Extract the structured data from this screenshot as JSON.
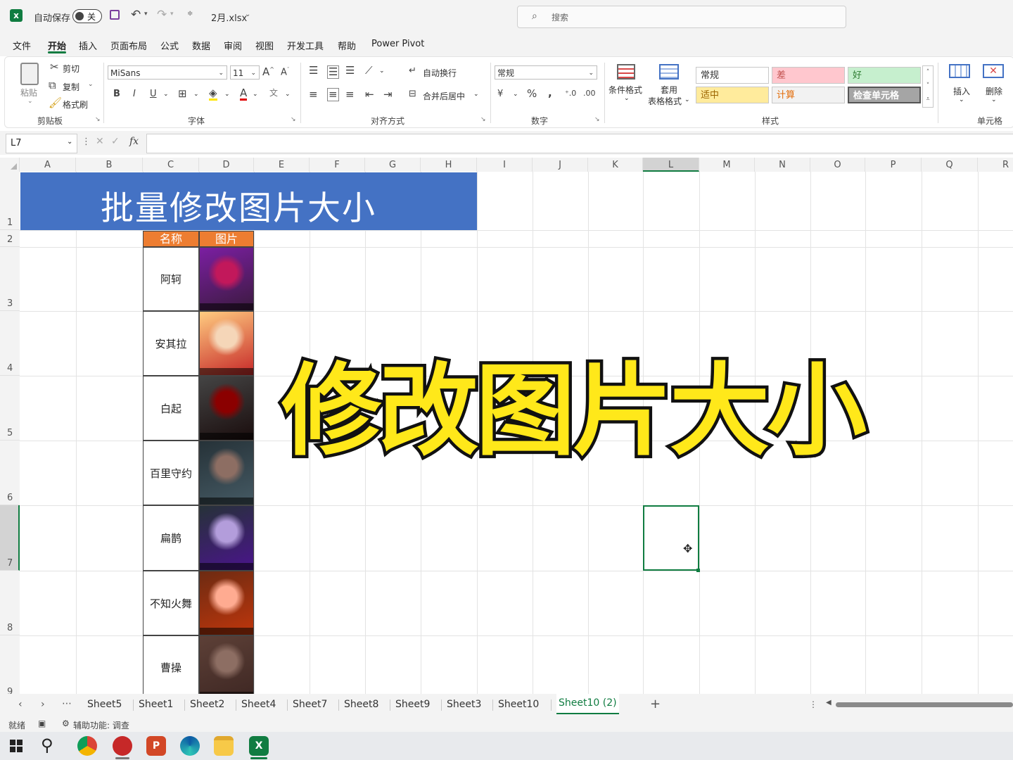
{
  "titlebar": {
    "autosave_label": "自动保存",
    "autosave_state": "关",
    "filename": "2月.xlsx",
    "search_placeholder": "搜索"
  },
  "menu": {
    "tabs": [
      "文件",
      "开始",
      "插入",
      "页面布局",
      "公式",
      "数据",
      "审阅",
      "视图",
      "开发工具",
      "帮助",
      "Power Pivot"
    ],
    "active": "开始"
  },
  "ribbon": {
    "clipboard": {
      "paste": "粘贴",
      "cut": "剪切",
      "copy": "复制",
      "format_painter": "格式刷",
      "label": "剪贴板"
    },
    "font": {
      "family": "MiSans",
      "size": "11",
      "label": "字体"
    },
    "alignment": {
      "wrap": "自动换行",
      "merge": "合并后居中",
      "label": "对齐方式"
    },
    "number": {
      "format": "常规",
      "label": "数字"
    },
    "styles": {
      "conditional": "条件格式",
      "table_format_1": "套用",
      "table_format_2": "表格格式",
      "label": "样式",
      "cells": [
        {
          "text": "常规",
          "bg": "#ffffff",
          "fg": "#333333"
        },
        {
          "text": "差",
          "bg": "#ffc7ce",
          "fg": "#c0504d"
        },
        {
          "text": "好",
          "bg": "#c6efce",
          "fg": "#2e7d32"
        },
        {
          "text": "适中",
          "bg": "#ffeb9c",
          "fg": "#9c6500"
        },
        {
          "text": "计算",
          "bg": "#f2f2f2",
          "fg": "#e36c09"
        },
        {
          "text": "检查单元格",
          "bg": "#a5a5a5",
          "fg": "#ffffff"
        }
      ]
    },
    "cells": {
      "insert": "插入",
      "delete": "删除",
      "label": "单元格"
    }
  },
  "formula": {
    "name_box": "L7",
    "fx": "fx",
    "value": ""
  },
  "grid": {
    "columns": [
      "A",
      "B",
      "C",
      "D",
      "E",
      "F",
      "G",
      "H",
      "I",
      "J",
      "K",
      "L",
      "M",
      "N",
      "O",
      "P",
      "Q",
      "R"
    ],
    "rows": [
      "1",
      "2",
      "3",
      "4",
      "5",
      "6",
      "7",
      "8",
      "9"
    ],
    "banner_title": "批量修改图片大小",
    "header_name": "名称",
    "header_pic": "图片",
    "names": [
      "阿轲",
      "安其拉",
      "白起",
      "百里守约",
      "扁鹊",
      "不知火舞",
      "曹操"
    ],
    "selected_cell": "L7",
    "overlay_caption": "修改图片大小"
  },
  "sheets": {
    "tabs": [
      "Sheet5",
      "Sheet1",
      "Sheet2",
      "Sheet4",
      "Sheet7",
      "Sheet8",
      "Sheet9",
      "Sheet3",
      "Sheet10",
      "Sheet10 (2)"
    ],
    "active": "Sheet10 (2)"
  },
  "status": {
    "ready": "就绪",
    "accessibility": "辅助功能: 调查"
  },
  "colors": {
    "excel_green": "#107c41",
    "banner_blue": "#4472c4",
    "header_orange": "#ed7d31",
    "caption_yellow": "#ffe81a"
  }
}
